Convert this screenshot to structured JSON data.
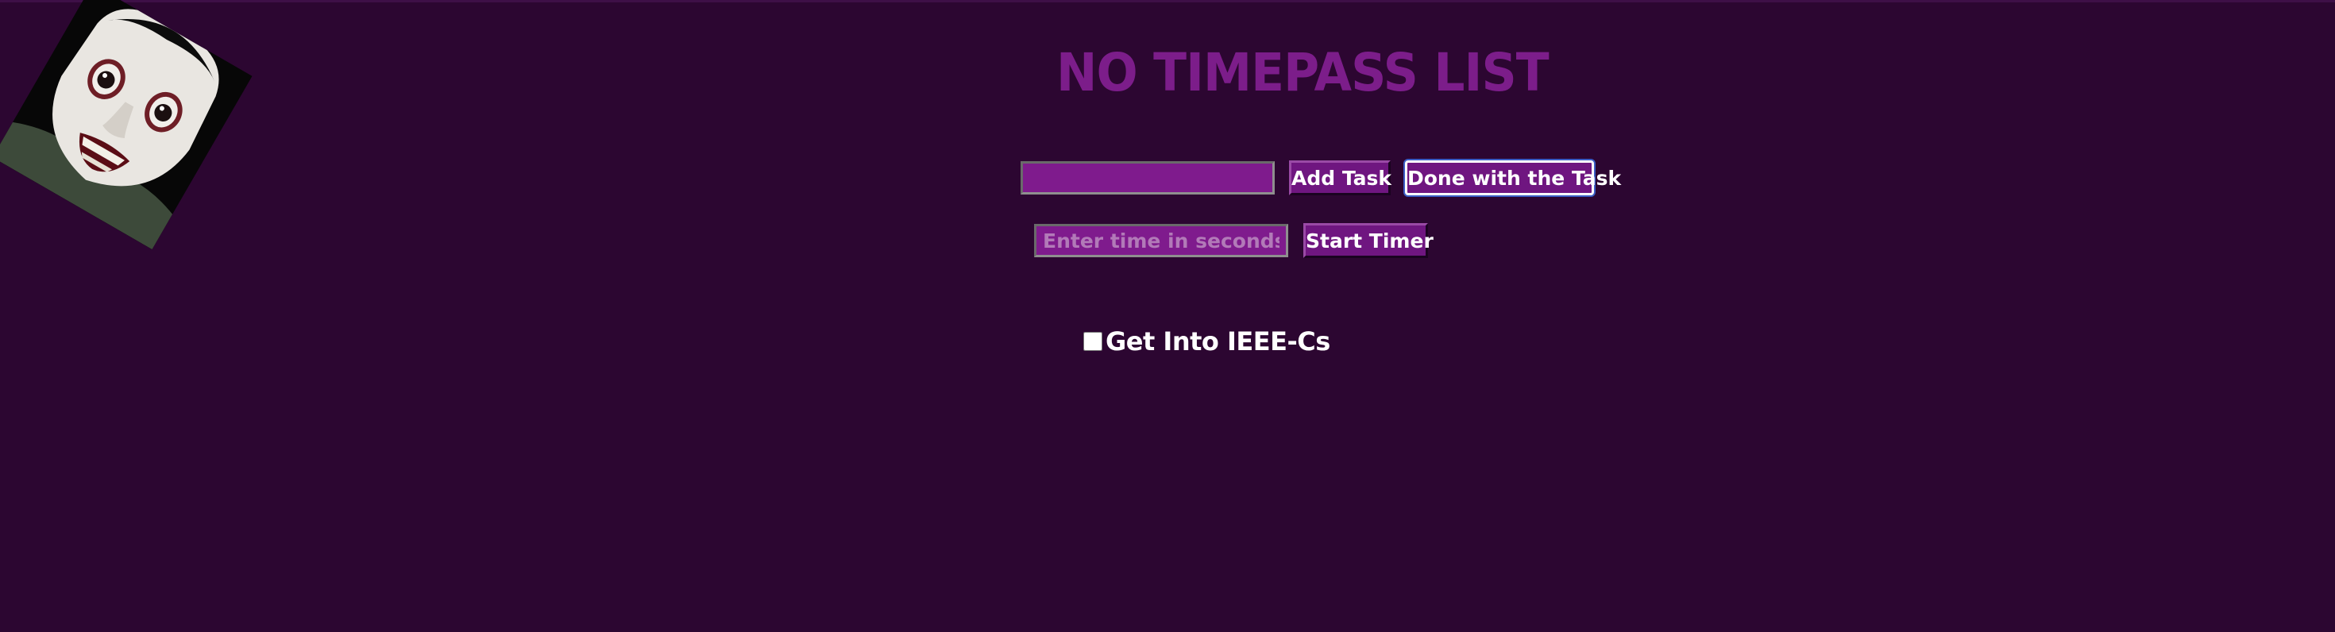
{
  "page": {
    "title": "NO TIMEPASS LIST"
  },
  "task_form": {
    "task_input_value": "",
    "add_label": "Add Task",
    "done_label": "Done with the Task"
  },
  "timer_form": {
    "time_input_value": "",
    "time_input_placeholder": "Enter time in seconds",
    "start_label": "Start Timer"
  },
  "tasks": [
    {
      "label": "Get Into IEEE-Cs",
      "checked": false
    }
  ],
  "colors": {
    "background": "#2c0631",
    "title": "#7c1d8a",
    "field": "#7f1b8d",
    "button": "#6f1680"
  },
  "images": {
    "photo": "face-photo"
  }
}
